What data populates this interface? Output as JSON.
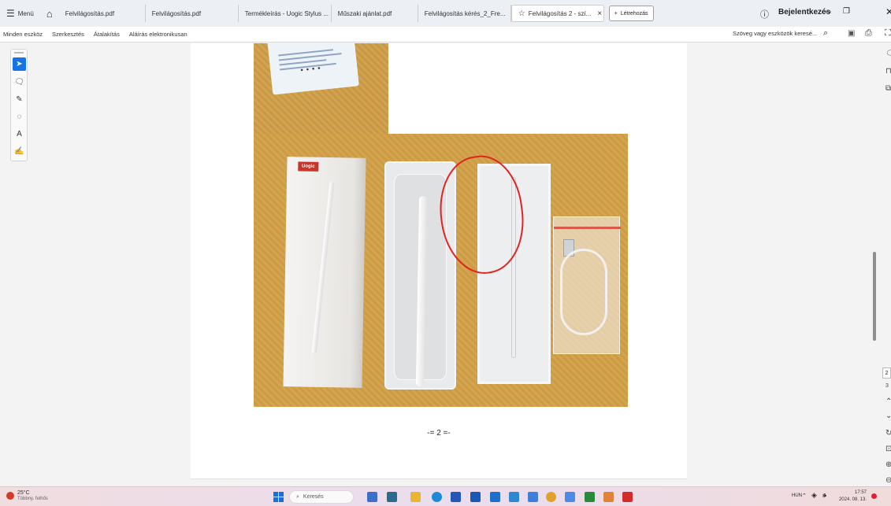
{
  "tabbar": {
    "menu_label": "Menü",
    "tabs": [
      {
        "label": "Felvilágosítás.pdf",
        "active": false
      },
      {
        "label": "Felvilágosítás.pdf",
        "active": false
      },
      {
        "label": "Termékleírás - Uogic Stylus ...",
        "active": false
      },
      {
        "label": "Műszaki ajánlat.pdf",
        "active": false
      },
      {
        "label": "Felvilágosítás kérés_2_Fre...",
        "active": false
      },
      {
        "label": "Felvilágosítás 2 - szí...",
        "active": true
      }
    ],
    "new_tab_label": "Létrehozás",
    "signin_label": "Bejelentkezés"
  },
  "toolbar": {
    "items": [
      "Minden eszköz",
      "Szerkesztés",
      "Átalakítás",
      "Aláírás elektronikusan"
    ],
    "search_placeholder": "Szöveg vagy eszközök keresé..."
  },
  "document": {
    "box_brand": "Uogic",
    "page_number_text": "-= 2 =-"
  },
  "side_panel": {
    "page_current": "2",
    "page_total": "3"
  },
  "taskbar": {
    "weather_temp": "25°C",
    "weather_desc": "Többny. felhős",
    "search_label": "Keresés",
    "language": "HUN",
    "time": "17:57",
    "date": "2024. 08. 13."
  }
}
